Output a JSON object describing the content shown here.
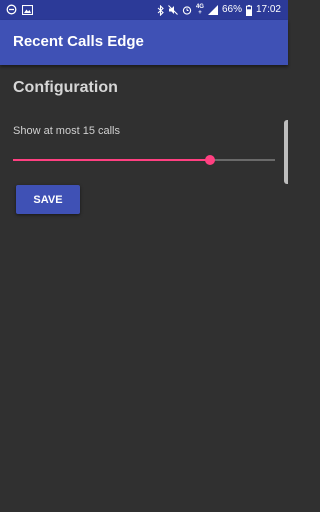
{
  "status_bar": {
    "network_top": "4G",
    "network_bottom": "+",
    "battery_percent": "66%",
    "time": "17:02"
  },
  "app_bar": {
    "title": "Recent Calls Edge"
  },
  "configuration": {
    "title": "Configuration",
    "slider": {
      "caption": "Show at most 15 calls",
      "value_fraction": 0.75
    },
    "save_label": "SAVE"
  },
  "colors": {
    "primary": "#3f51b5",
    "primary_dark": "#2c3a98",
    "accent": "#ff4081",
    "background": "#303030"
  }
}
